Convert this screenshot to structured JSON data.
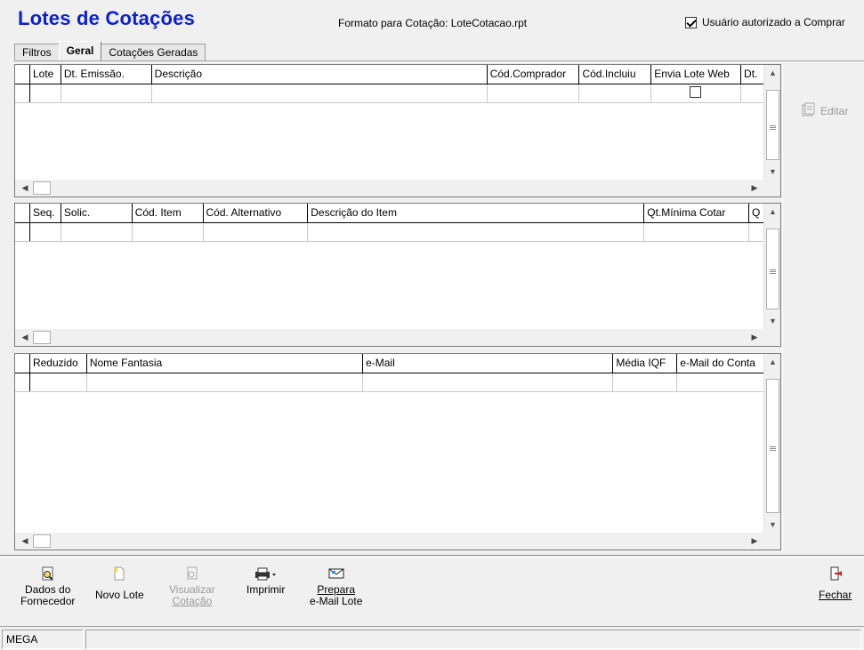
{
  "header": {
    "title": "Lotes de Cotações",
    "format_text": "Formato para Cotação: LoteCotacao.rpt",
    "authorized_label": "Usuário autorizado a Comprar",
    "authorized_checked": true
  },
  "tabs": [
    {
      "label": "Filtros",
      "active": false
    },
    {
      "label": "Geral",
      "active": true
    },
    {
      "label": "Cotações Geradas",
      "active": false
    }
  ],
  "grid1": {
    "columns": [
      "Lote",
      "Dt. Emissão.",
      "Descrição",
      "Cód.Comprador",
      "Cód.Incluiu",
      "Envia Lote Web",
      "Dt."
    ]
  },
  "grid2": {
    "columns": [
      "Seq.",
      "Solic.",
      "Cód. Item",
      "Cód. Alternativo",
      "Descrição do Item",
      "Qt.Mínima Cotar",
      "Q"
    ]
  },
  "grid3": {
    "columns": [
      "Reduzido",
      "Nome Fantasia",
      "e-Mail",
      "Média IQF",
      "e-Mail do Conta"
    ]
  },
  "side": {
    "edit_label": "Editar"
  },
  "toolbar": {
    "dados_line1": "Dados do",
    "dados_line2": "Fornecedor",
    "novo_lote": "Novo Lote",
    "visualizar_line1": "Visualizar",
    "visualizar_line2": "Cotação",
    "imprimir": "Imprimir",
    "prepara_line1": "Prepara",
    "prepara_line2": "e-Mail Lote",
    "fechar": "Fechar"
  },
  "status": {
    "left": "MEGA",
    "right": ""
  }
}
